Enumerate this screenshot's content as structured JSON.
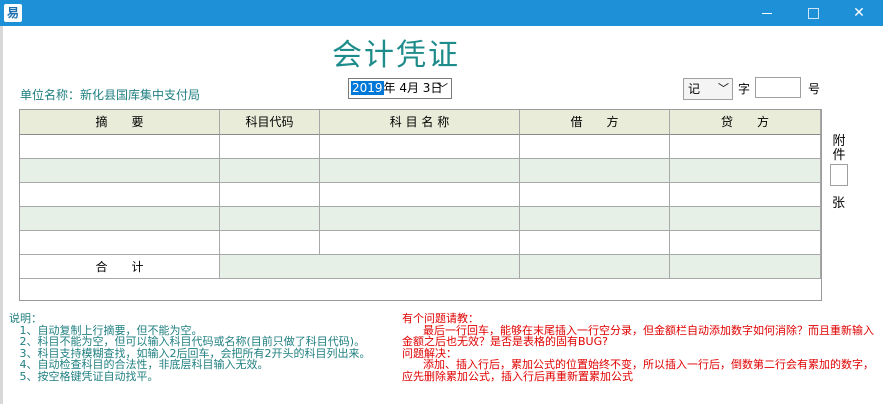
{
  "window": {
    "icon_glyph": "易",
    "controls": {
      "minimize": "minimize",
      "maximize": "maximize",
      "close": "✕"
    }
  },
  "form": {
    "title": "会计凭证",
    "unit_label": "单位名称：新化县国库集中支付局",
    "date": {
      "year": "2019",
      "rest": "年  4月  3日"
    },
    "voucher_type": "记",
    "zi_label": "字",
    "number_value": "",
    "hao_label": "号",
    "attachment_label_top": "附件",
    "attachment_value": "",
    "attachment_label_bottom": "张"
  },
  "table": {
    "headers": [
      "摘　　要",
      "科目代码",
      "科 目 名 称",
      "借　　方",
      "贷　　方"
    ],
    "rows": [
      [
        "",
        "",
        "",
        "",
        ""
      ],
      [
        "",
        "",
        "",
        "",
        ""
      ],
      [
        "",
        "",
        "",
        "",
        ""
      ],
      [
        "",
        "",
        "",
        "",
        ""
      ],
      [
        "",
        "",
        "",
        "",
        ""
      ]
    ],
    "total_label": "合　　计",
    "total_debit": "",
    "total_credit": ""
  },
  "notes": {
    "left": "说明：\n   1、自动复制上行摘要，但不能为空。\n   2、科目不能为空，但可以输入科目代码或名称(目前只做了科目代码)。\n   3、科目支持模糊查找，如输入2后回车，会把所有2开头的科目列出来。\n   4、自动检查科目的合法性，非底层科目输入无效。\n   5、按空格键凭证自动找平。",
    "right": "有个问题请教：\n      最后一行回车，能够在末尾插入一行空分录，但金额栏自动添加数字如何消除？而且重新输入金额之后也无效？是否是表格的固有BUG?\n问题解决：\n      添加、插入行后，累加公式的位置始终不变，所以插入一行后，倒数第二行会有累加的数字，应先删除累加公式，插入行后再重新置累加公式"
  }
}
